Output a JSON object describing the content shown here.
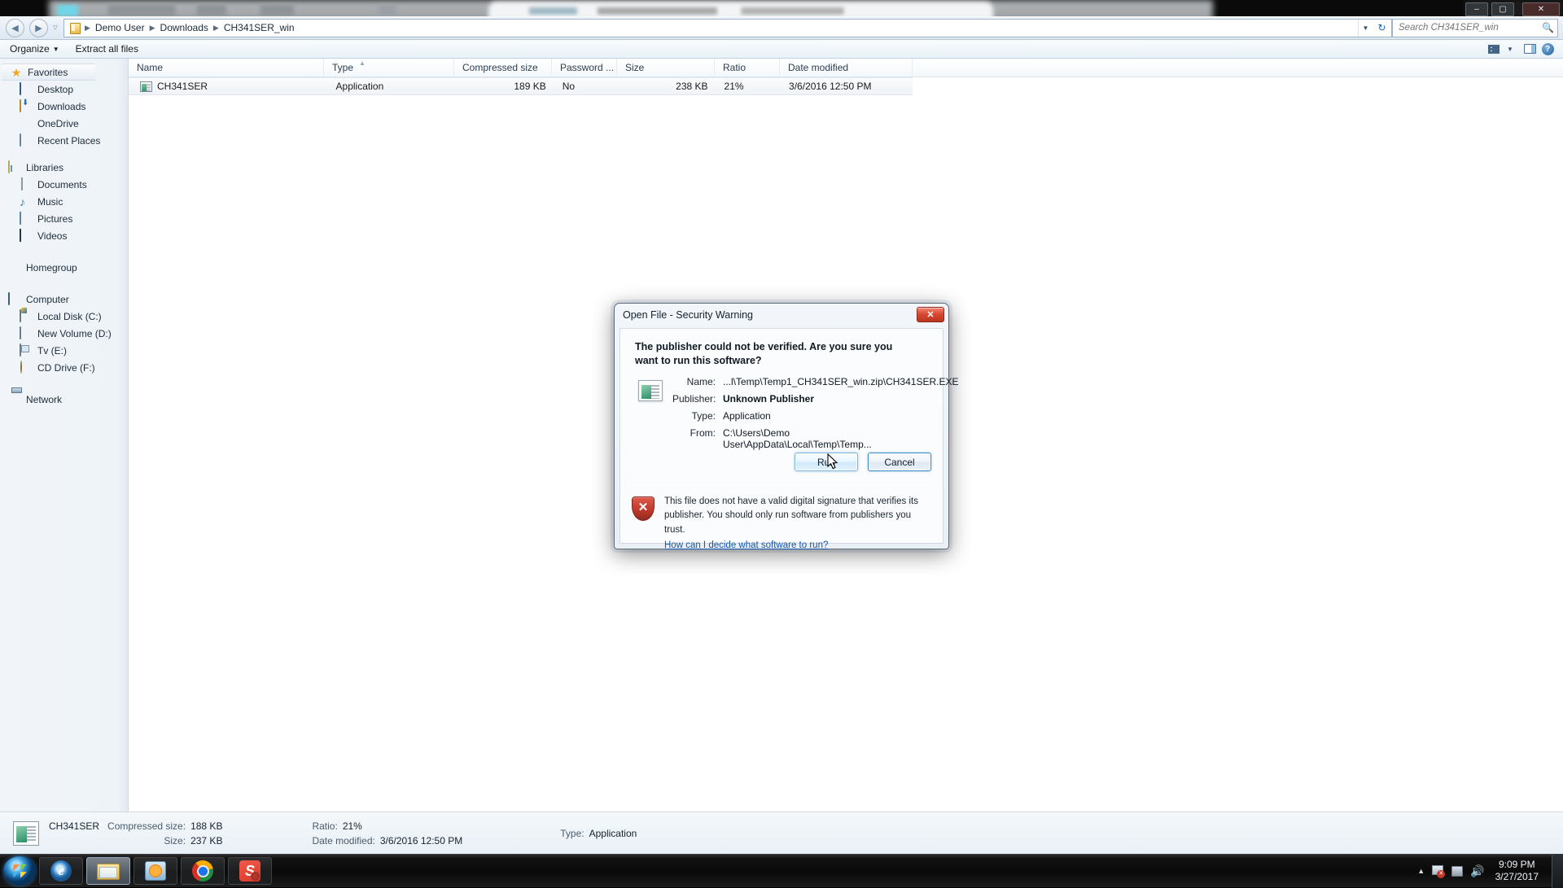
{
  "window": {
    "title_controls": {
      "minimize": "–",
      "maximize": "▢",
      "close": "✕"
    }
  },
  "address_bar": {
    "back": "◀",
    "forward": "▶",
    "history_dropdown": "▽",
    "breadcrumb": [
      "Demo User",
      "Downloads",
      "CH341SER_win"
    ],
    "breadcrumb_separator": "▶",
    "crumb_chevron": "▼",
    "refresh_icon": "↻",
    "search": {
      "placeholder": "Search CH341SER_win",
      "value": "",
      "icon": "search-icon"
    }
  },
  "toolbar": {
    "organize_label": "Organize",
    "organize_caret": "▼",
    "extract_label": "Extract all files",
    "view_caret": "▼",
    "help_glyph": "?"
  },
  "sidebar": {
    "groups": [
      {
        "header": {
          "label": "Favorites",
          "icon": "star-icon",
          "selected": true
        },
        "items": [
          {
            "label": "Desktop",
            "icon": "monitor-icon"
          },
          {
            "label": "Downloads",
            "icon": "download-folder-icon"
          },
          {
            "label": "OneDrive",
            "icon": "cloud-icon"
          },
          {
            "label": "Recent Places",
            "icon": "recent-places-icon"
          }
        ]
      },
      {
        "header": {
          "label": "Libraries",
          "icon": "library-icon",
          "selected": false
        },
        "items": [
          {
            "label": "Documents",
            "icon": "document-icon"
          },
          {
            "label": "Music",
            "icon": "music-note-icon"
          },
          {
            "label": "Pictures",
            "icon": "picture-icon"
          },
          {
            "label": "Videos",
            "icon": "video-icon"
          }
        ]
      },
      {
        "header": {
          "label": "Homegroup",
          "icon": "homegroup-icon",
          "selected": false
        },
        "items": []
      },
      {
        "header": {
          "label": "Computer",
          "icon": "computer-icon",
          "selected": false
        },
        "items": [
          {
            "label": "Local Disk (C:)",
            "icon": "system-disk-icon"
          },
          {
            "label": "New Volume (D:)",
            "icon": "disk-icon"
          },
          {
            "label": "Tv (E:)",
            "icon": "disk-icon"
          },
          {
            "label": "CD Drive (F:)",
            "icon": "cd-drive-icon"
          }
        ]
      },
      {
        "header": {
          "label": "Network",
          "icon": "network-icon",
          "selected": false
        },
        "items": []
      }
    ]
  },
  "file_list": {
    "columns": [
      "Name",
      "Type",
      "Compressed size",
      "Password ...",
      "Size",
      "Ratio",
      "Date modified"
    ],
    "sort_indicator": "▲",
    "rows": [
      {
        "name": "CH341SER",
        "type": "Application",
        "compressed_size": "189 KB",
        "password": "No",
        "size": "238 KB",
        "ratio": "21%",
        "date_modified": "3/6/2016 12:50 PM",
        "icon": "application-file-icon",
        "selected": true
      }
    ]
  },
  "status_bar": {
    "name": "CH341SER",
    "compressed_size_label": "Compressed size:",
    "compressed_size_value": "188 KB",
    "size_label": "Size:",
    "size_value": "237 KB",
    "ratio_label": "Ratio:",
    "ratio_value": "21%",
    "date_modified_label": "Date modified:",
    "date_modified_value": "3/6/2016 12:50 PM",
    "type_label": "Type:",
    "type_value": "Application",
    "icon": "application-file-icon"
  },
  "dialog": {
    "title": "Open File - Security Warning",
    "close_glyph": "✕",
    "heading": "The publisher could not be verified.  Are you sure you want to run this software?",
    "file_icon": "application-file-icon",
    "fields": [
      {
        "label": "Name:",
        "value": "...l\\Temp\\Temp1_CH341SER_win.zip\\CH341SER.EXE",
        "bold": false
      },
      {
        "label": "Publisher:",
        "value": "Unknown Publisher",
        "bold": true
      },
      {
        "label": "Type:",
        "value": "Application",
        "bold": false
      },
      {
        "label": "From:",
        "value": "C:\\Users\\Demo User\\AppData\\Local\\Temp\\Temp...",
        "bold": false
      }
    ],
    "buttons": [
      {
        "label": "Run",
        "state": "hover"
      },
      {
        "label": "Cancel",
        "state": "default"
      }
    ],
    "footer_text": "This file does not have a valid digital signature that verifies its publisher.  You should only run software from publishers you trust.",
    "footer_link": "How can I decide what software to run?",
    "footer_icon": "warning-shield-icon"
  },
  "taskbar": {
    "start_label": "Start",
    "tasks": [
      {
        "name": "internet-explorer",
        "glyph": "e",
        "state": "pinned"
      },
      {
        "name": "windows-explorer",
        "glyph": "",
        "state": "active"
      },
      {
        "name": "windows-media-player",
        "glyph": "",
        "state": "pinned"
      },
      {
        "name": "google-chrome",
        "glyph": "",
        "state": "pinned"
      },
      {
        "name": "sublime-text",
        "glyph": "S",
        "state": "pinned"
      }
    ],
    "tray": {
      "show_hidden": "▲",
      "action_center": "flag-icon",
      "network": "network-icon",
      "volume": "🔊",
      "time": "9:09 PM",
      "date": "3/27/2017"
    }
  }
}
